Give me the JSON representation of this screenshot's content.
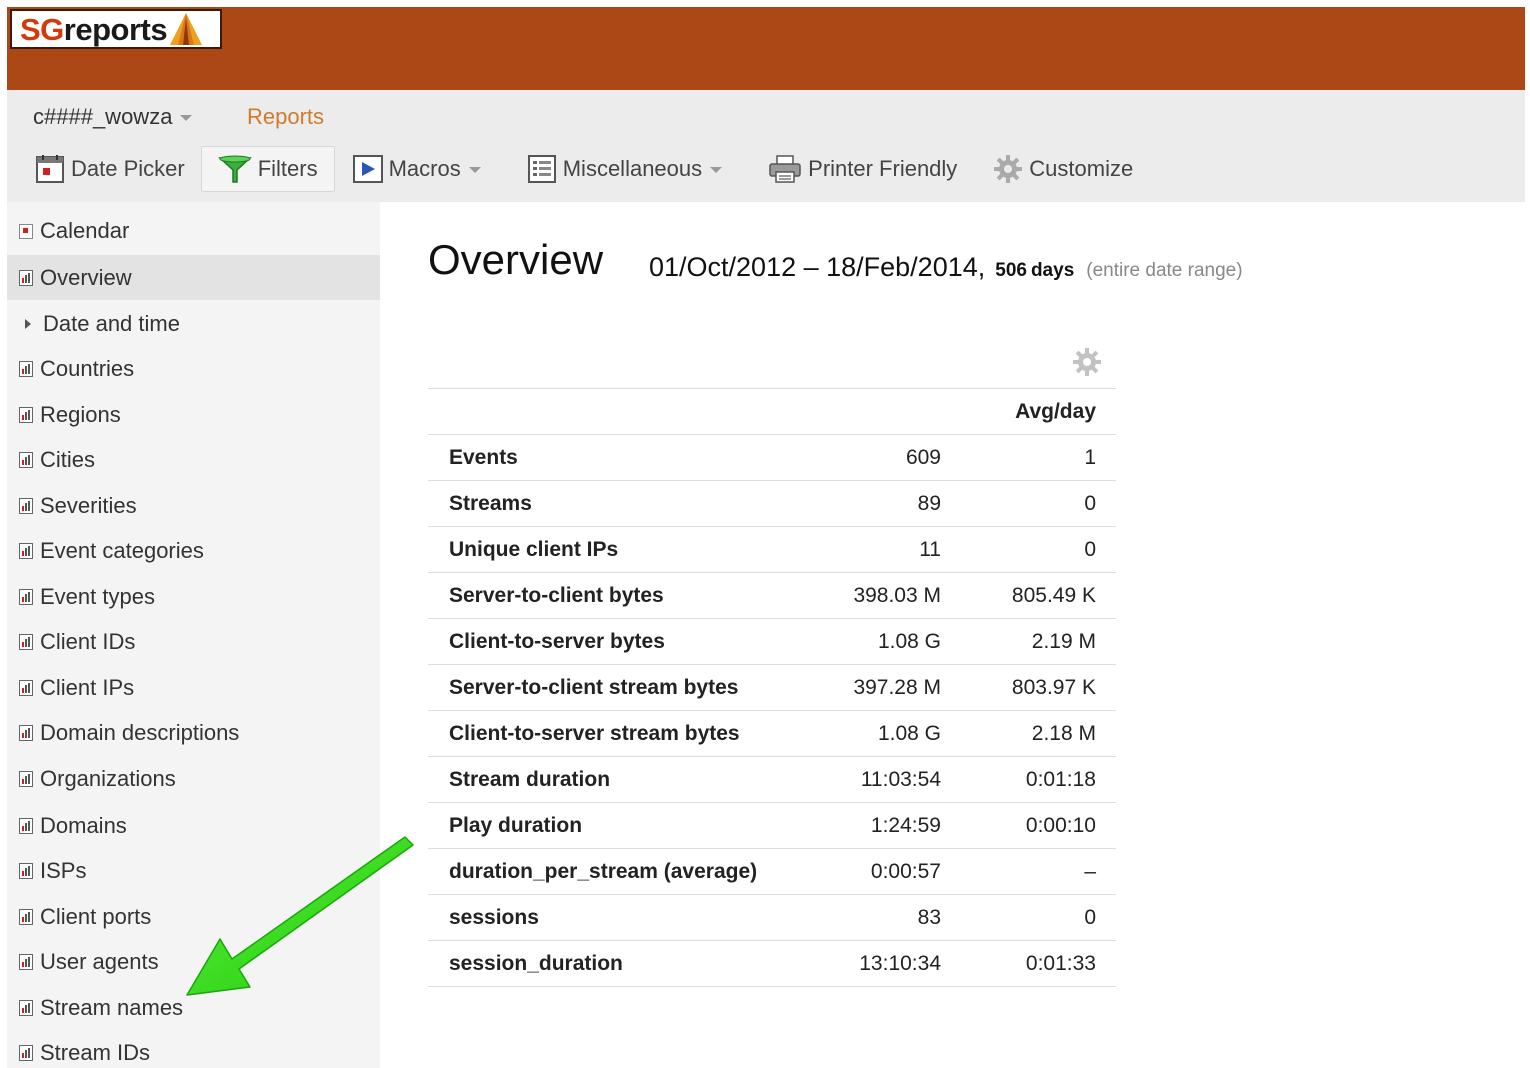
{
  "app": {
    "logo_text_sg": "SG",
    "logo_text_rest": "reports"
  },
  "menubar": {
    "profile": "c####_wowza",
    "reports": "Reports",
    "toolbar": [
      {
        "label": "Date Picker",
        "icon": "calendar-icon"
      },
      {
        "label": "Filters",
        "icon": "funnel-icon"
      },
      {
        "label": "Macros",
        "icon": "play-icon"
      },
      {
        "label": "Miscellaneous",
        "icon": "list-icon"
      },
      {
        "label": "Printer Friendly",
        "icon": "printer-icon"
      },
      {
        "label": "Customize",
        "icon": "gear-icon"
      }
    ]
  },
  "sidebar": {
    "selected": "Overview",
    "items": [
      "Calendar",
      "Overview",
      "Date and time",
      "Countries",
      "Regions",
      "Cities",
      "Severities",
      "Event categories",
      "Event types",
      "Client IDs",
      "Client IPs",
      "Domain descriptions",
      "Organizations",
      "Domains",
      "ISPs",
      "Client ports",
      "User agents",
      "Stream names",
      "Stream IDs"
    ]
  },
  "main": {
    "title": "Overview",
    "date_range": "01/Oct/2012 – 18/Feb/2014,",
    "days_count": "506",
    "days_unit": "days",
    "range_note": "(entire date range)",
    "table": {
      "headers": [
        "",
        "",
        "Avg/day"
      ],
      "rows": [
        [
          "Events",
          "609",
          "1"
        ],
        [
          "Streams",
          "89",
          "0"
        ],
        [
          "Unique client IPs",
          "11",
          "0"
        ],
        [
          "Server-to-client bytes",
          "398.03 M",
          "805.49 K"
        ],
        [
          "Client-to-server bytes",
          "1.08 G",
          "2.19 M"
        ],
        [
          "Server-to-client stream bytes",
          "397.28 M",
          "803.97 K"
        ],
        [
          "Client-to-server stream bytes",
          "1.08 G",
          "2.18 M"
        ],
        [
          "Stream duration",
          "11:03:54",
          "0:01:18"
        ],
        [
          "Play duration",
          "1:24:59",
          "0:00:10"
        ],
        [
          "duration_per_stream (average)",
          "0:00:57",
          "–"
        ],
        [
          "sessions",
          "83",
          "0"
        ],
        [
          "session_duration",
          "13:10:34",
          "0:01:33"
        ]
      ]
    }
  },
  "colors": {
    "brand_bar": "#ab4815",
    "reports_link": "#d27a2c",
    "annotation_arrow": "#2fdc0e"
  }
}
